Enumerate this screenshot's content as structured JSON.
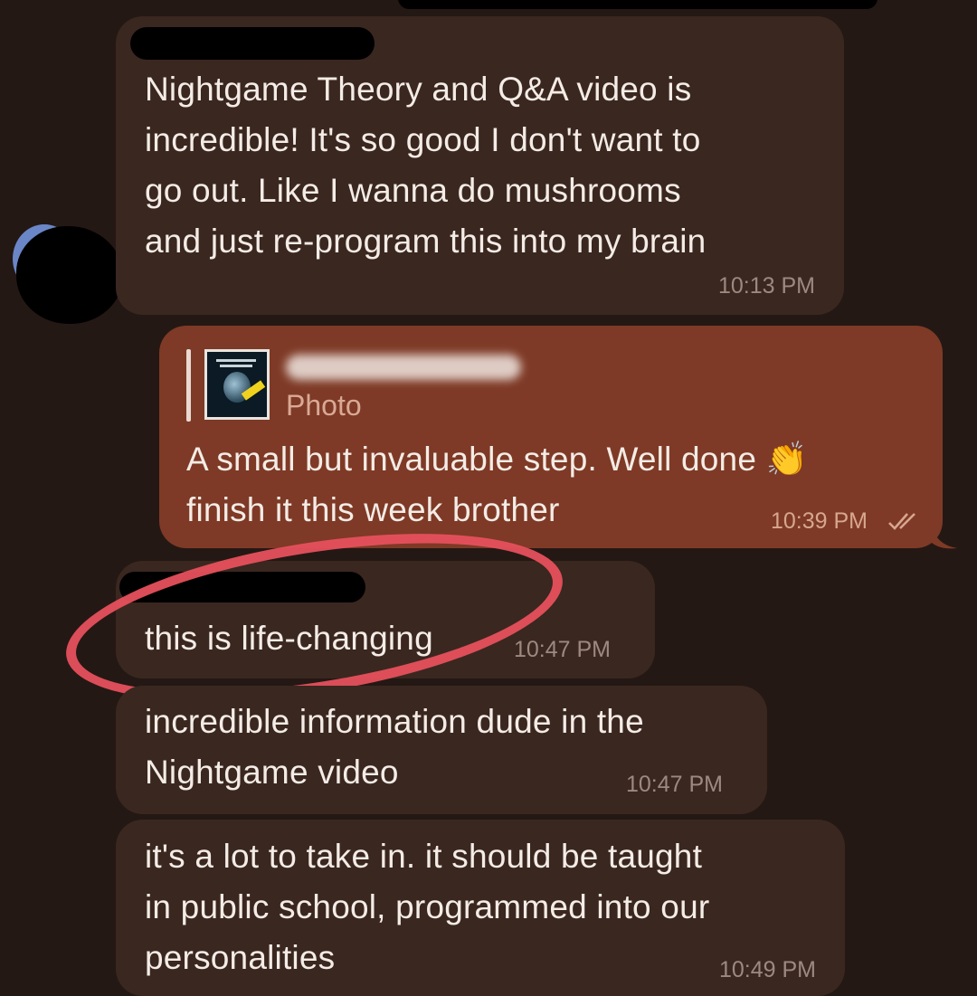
{
  "messages": [
    {
      "direction": "incoming",
      "text": "Nightgame Theory and Q&A video is\nincredible!  It's so good I don't want to\ngo out.  Like I wanna do mushrooms\nand just re-program this into my brain",
      "time": "10:13 PM"
    },
    {
      "direction": "outgoing",
      "reply_to": {
        "label": "Photo",
        "thumbnail": "book-cover-thumbnail"
      },
      "text": "A small but invaluable step. Well done 👏\nfinish it this week brother",
      "time": "10:39 PM",
      "status_icon": "double-check-icon"
    },
    {
      "direction": "incoming",
      "text": "this is life-changing",
      "time": "10:47 PM"
    },
    {
      "direction": "incoming",
      "text": "incredible information dude in the\nNightgame video",
      "time": "10:47 PM"
    },
    {
      "direction": "incoming",
      "text": "it's a lot to take in. it should be  taught\nin public school, programmed into our\npersonalities",
      "time": "10:49 PM"
    }
  ],
  "colors": {
    "background": "#241814",
    "incoming_bubble": "#3a2720",
    "outgoing_bubble": "#7e3a26",
    "annotation_circle": "#e6505c"
  }
}
